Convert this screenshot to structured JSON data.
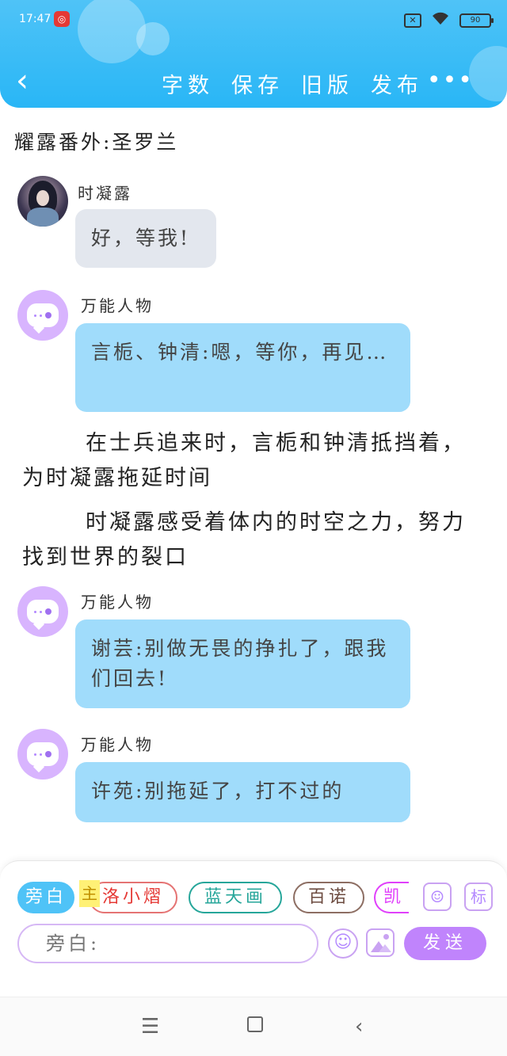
{
  "status_bar": {
    "time": "17:47",
    "app_icon_glyph": "◎",
    "sim_label": "✕",
    "battery": "90"
  },
  "header": {
    "back_glyph": "‹",
    "actions": [
      "字数",
      "保存",
      "旧版",
      "发布"
    ],
    "more_glyph": "•••",
    "accent_color": "#29b6f6"
  },
  "story_title": "耀露番外:圣罗兰",
  "messages": [
    {
      "sender": "时凝露",
      "text": "好，等我!",
      "bubble_color": "#e3e7ee",
      "avatar": "character-photo"
    },
    {
      "sender": "万能人物",
      "text": "言栀、钟清:嗯，等你，再见…",
      "bubble_color": "#a0dcfb",
      "avatar": "chat-bot-icon"
    },
    {
      "sender": "万能人物",
      "text": "谢芸:别做无畏的挣扎了，跟我们回去!",
      "bubble_color": "#a0dcfb",
      "avatar": "chat-bot-icon"
    },
    {
      "sender": "万能人物",
      "text": "许苑:别拖延了，打不过的",
      "bubble_color": "#a0dcfb",
      "avatar": "chat-bot-icon"
    }
  ],
  "narrations": [
    "在士兵追来时，言栀和钟清抵挡着，为时凝露拖延时间",
    "时凝露感受着体内的时空之力，努力找到世界的裂口"
  ],
  "composer": {
    "chips": {
      "narration": "旁白",
      "main_tag": "主",
      "luo": "洛小熠",
      "lan": "蓝天画",
      "bai": "百诺",
      "kai": "凯"
    },
    "icons": {
      "role": "☺",
      "tag": "标"
    },
    "input_placeholder": "旁白:",
    "emoji_glyph": "☺",
    "send_label": "发送"
  },
  "system_nav": {
    "menu": "☰",
    "back": "‹"
  }
}
